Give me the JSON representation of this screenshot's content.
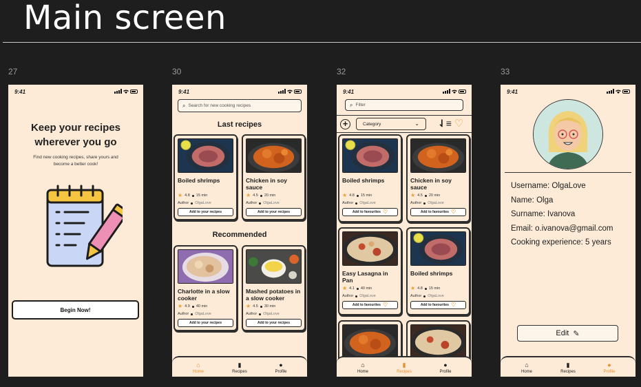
{
  "page": {
    "title": "Main screen"
  },
  "frames": [
    {
      "number": "27"
    },
    {
      "number": "30"
    },
    {
      "number": "32"
    },
    {
      "number": "33"
    }
  ],
  "status": {
    "time": "9:41"
  },
  "onboarding": {
    "heading_line1": "Keep your recipes",
    "heading_line2": "wherever you go",
    "subtitle_line1": "Find new cooking recipes, share yours and",
    "subtitle_line2": "become a better cook!",
    "begin_button": "Begin Now!"
  },
  "home": {
    "search_placeholder": "Search for new cooking recipes",
    "last_title": "Last recipes",
    "recommended_title": "Recommended",
    "last": [
      {
        "name": "Boiled shrimps",
        "rating": "4.8",
        "time": "15 min",
        "author_label": "Author",
        "author": "OlgaLove",
        "button": "Add to your recipes"
      },
      {
        "name": "Chicken in soy sauce",
        "rating": "4.5",
        "time": "20 min",
        "author_label": "Author",
        "author": "OlgaLove",
        "button": "Add to your recipes"
      }
    ],
    "recommended": [
      {
        "name": "Charlotte in a slow cooker",
        "rating": "4.9",
        "time": "40 min",
        "author_label": "Author",
        "author": "OlgaLove",
        "button": "Add to your recipes"
      },
      {
        "name": "Mashed potatoes in a slow cooker",
        "rating": "4.5",
        "time": "30 min",
        "author_label": "Author",
        "author": "OlgaLove",
        "button": "Add to your recipes"
      }
    ]
  },
  "recipes": {
    "filter_placeholder": "Filter",
    "category_label": "Category",
    "cards": [
      {
        "name": "Boiled shrimps",
        "rating": "4.8",
        "time": "15 min",
        "author_label": "Author",
        "author": "OlgaLove",
        "button": "Add to favourites"
      },
      {
        "name": "Chicken in soy sauce",
        "rating": "4.5",
        "time": "20 min",
        "author_label": "Author",
        "author": "OlgaLove",
        "button": "Add to favourites"
      },
      {
        "name": "Easy Lasagna in Pan",
        "rating": "4.1",
        "time": "40 min",
        "author_label": "Author",
        "author": "OlgaLove",
        "button": "Add to favourites"
      },
      {
        "name": "Boiled shrimps",
        "rating": "4.8",
        "time": "15 min",
        "author_label": "Author",
        "author": "OlgaLove",
        "button": "Add to favourites"
      }
    ]
  },
  "profile": {
    "username": "Username: OlgaLove",
    "name": "Name: Olga",
    "surname": "Surname: Ivanova",
    "email": "Email: o.ivanova@gmail.com",
    "experience": "Cooking experience: 5 years",
    "edit_button": "Edit"
  },
  "tabs": {
    "home": "Home",
    "recipes": "Recipes",
    "profile": "Profile"
  },
  "colors": {
    "background": "#1e1e1e",
    "phone": "#fdebd8",
    "accent": "#e8902b",
    "outline": "#2d2d2d"
  }
}
